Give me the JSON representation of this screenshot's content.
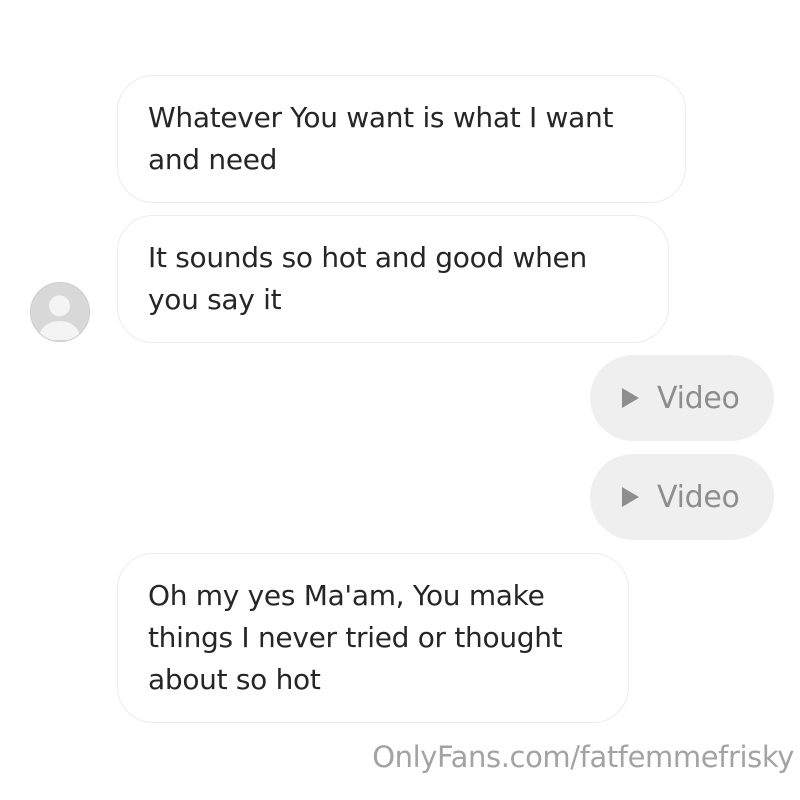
{
  "messages": [
    {
      "sender": "other",
      "lines": [
        "Whatever You want is what I want",
        "and need"
      ]
    },
    {
      "sender": "other",
      "lines": [
        "It sounds so hot and good when",
        "you say it"
      ]
    },
    {
      "sender": "self",
      "type": "video",
      "label": "Video",
      "icon": "play-icon"
    },
    {
      "sender": "self",
      "type": "video",
      "label": "Video",
      "icon": "play-icon"
    },
    {
      "sender": "other",
      "lines": [
        "Oh my yes Ma'am, You make",
        "things I never tried or thought",
        "about so hot"
      ]
    }
  ],
  "avatar": {
    "icon": "default-user-avatar-icon"
  },
  "watermark": {
    "text": "OnlyFans.com/fatfemmefrisky"
  },
  "colors": {
    "incoming_bubble_bg": "#ffffff",
    "incoming_bubble_border": "#ececec",
    "outgoing_video_bg": "#efefef",
    "video_text": "#8e8e8e",
    "message_text": "#262626",
    "watermark_text": "#a3a3a3"
  }
}
